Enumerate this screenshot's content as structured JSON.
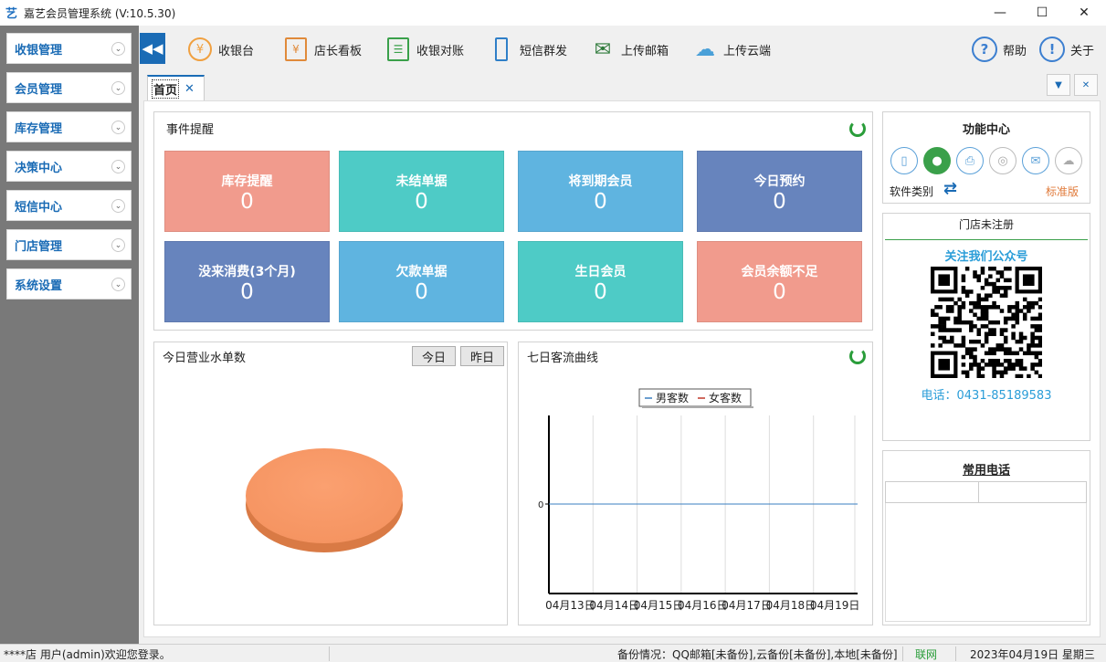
{
  "window": {
    "title": "嘉艺会员管理系统 (V:10.5.30)",
    "app_icon": "艺",
    "minimize": "—",
    "maximize": "☐",
    "close": "✕"
  },
  "sidebar": {
    "items": [
      {
        "label": "收银管理"
      },
      {
        "label": "会员管理"
      },
      {
        "label": "库存管理"
      },
      {
        "label": "决策中心"
      },
      {
        "label": "短信中心"
      },
      {
        "label": "门店管理"
      },
      {
        "label": "系统设置"
      }
    ]
  },
  "toolbar": {
    "collapse": "◀◀",
    "items": [
      {
        "label": "收银台",
        "icon": "yen-circle-icon"
      },
      {
        "label": "店长看板",
        "icon": "calendar-yen-icon"
      },
      {
        "label": "收银对账",
        "icon": "ledger-icon"
      },
      {
        "label": "短信群发",
        "icon": "phone-icon"
      },
      {
        "label": "上传邮箱",
        "icon": "mail-upload-icon"
      },
      {
        "label": "上传云端",
        "icon": "cloud-upload-icon"
      }
    ],
    "help": "帮助",
    "help_symbol": "?",
    "about": "关于",
    "about_symbol": "!"
  },
  "tabs": {
    "home_label": "首页",
    "home_close": "✕",
    "dropdown": "▼",
    "close": "✕"
  },
  "events": {
    "title": "事件提醒",
    "cards": [
      {
        "label": "库存提醒",
        "value": "0",
        "color": "#f19b8d"
      },
      {
        "label": "未结单据",
        "value": "0",
        "color": "#4ecbc6"
      },
      {
        "label": "将到期会员",
        "value": "0",
        "color": "#5fb4e0"
      },
      {
        "label": "今日预约",
        "value": "0",
        "color": "#6784bd"
      },
      {
        "label": "没来消费(3个月)",
        "value": "0",
        "color": "#6784bd"
      },
      {
        "label": "欠款单据",
        "value": "0",
        "color": "#5fb4e0"
      },
      {
        "label": "生日会员",
        "value": "0",
        "color": "#4ecbc6"
      },
      {
        "label": "会员余额不足",
        "value": "0",
        "color": "#f19b8d"
      }
    ]
  },
  "revenue": {
    "title": "今日营业水单数",
    "today_btn": "今日",
    "yesterday_btn": "昨日",
    "pie_color": "#f99a67"
  },
  "traffic": {
    "title": "七日客流曲线",
    "legend": [
      {
        "name": "男客数",
        "color": "#3a7fc1"
      },
      {
        "name": "女客数",
        "color": "#c0392b"
      }
    ]
  },
  "chart_data": {
    "type": "line",
    "title": "",
    "x": [
      "04月13日",
      "04月14日",
      "04月15日",
      "04月16日",
      "04月17日",
      "04月18日",
      "04月19日"
    ],
    "series": [
      {
        "name": "男客数",
        "values": [
          0,
          0,
          0,
          0,
          0,
          0,
          0
        ]
      },
      {
        "name": "女客数",
        "values": [
          0,
          0,
          0,
          0,
          0,
          0,
          0
        ]
      }
    ],
    "y_ticks": [
      "0"
    ],
    "grid": true,
    "legend_position": "top"
  },
  "function_center": {
    "title": "功能中心",
    "icons": [
      "phone-icon",
      "wechat-icon",
      "printer-icon",
      "fingerprint-icon",
      "mail-icon",
      "cloud-icon"
    ],
    "software_type_label": "软件类别",
    "swap_symbol": "⇄",
    "edition": "标准版"
  },
  "store": {
    "status": "门店未注册",
    "follow_label": "关注我们公众号",
    "phone": "电话：0431-85189583"
  },
  "common_phones": {
    "title": "常用电话"
  },
  "statusbar": {
    "user": "****店 用户(admin)欢迎您登录。",
    "backup": "备份情况：QQ邮箱[未备份],云备份[未备份],本地[未备份]",
    "network": "联网",
    "date": "2023年04月19日 星期三"
  }
}
